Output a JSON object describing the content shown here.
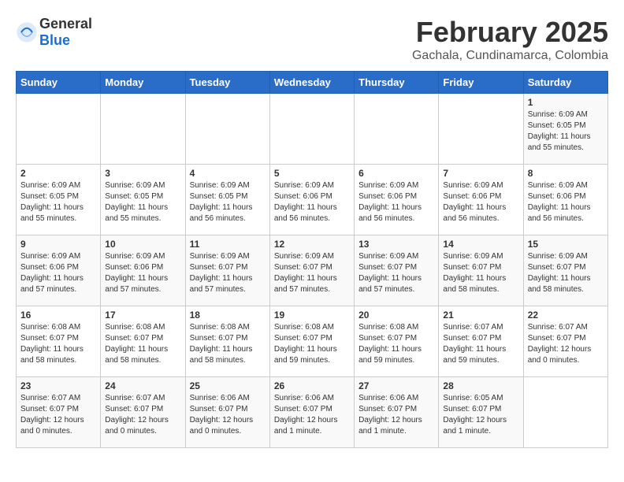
{
  "header": {
    "logo_general": "General",
    "logo_blue": "Blue",
    "month": "February 2025",
    "location": "Gachala, Cundinamarca, Colombia"
  },
  "weekdays": [
    "Sunday",
    "Monday",
    "Tuesday",
    "Wednesday",
    "Thursday",
    "Friday",
    "Saturday"
  ],
  "weeks": [
    [
      {
        "day": "",
        "info": ""
      },
      {
        "day": "",
        "info": ""
      },
      {
        "day": "",
        "info": ""
      },
      {
        "day": "",
        "info": ""
      },
      {
        "day": "",
        "info": ""
      },
      {
        "day": "",
        "info": ""
      },
      {
        "day": "1",
        "info": "Sunrise: 6:09 AM\nSunset: 6:05 PM\nDaylight: 11 hours\nand 55 minutes."
      }
    ],
    [
      {
        "day": "2",
        "info": "Sunrise: 6:09 AM\nSunset: 6:05 PM\nDaylight: 11 hours\nand 55 minutes."
      },
      {
        "day": "3",
        "info": "Sunrise: 6:09 AM\nSunset: 6:05 PM\nDaylight: 11 hours\nand 55 minutes."
      },
      {
        "day": "4",
        "info": "Sunrise: 6:09 AM\nSunset: 6:05 PM\nDaylight: 11 hours\nand 56 minutes."
      },
      {
        "day": "5",
        "info": "Sunrise: 6:09 AM\nSunset: 6:06 PM\nDaylight: 11 hours\nand 56 minutes."
      },
      {
        "day": "6",
        "info": "Sunrise: 6:09 AM\nSunset: 6:06 PM\nDaylight: 11 hours\nand 56 minutes."
      },
      {
        "day": "7",
        "info": "Sunrise: 6:09 AM\nSunset: 6:06 PM\nDaylight: 11 hours\nand 56 minutes."
      },
      {
        "day": "8",
        "info": "Sunrise: 6:09 AM\nSunset: 6:06 PM\nDaylight: 11 hours\nand 56 minutes."
      }
    ],
    [
      {
        "day": "9",
        "info": "Sunrise: 6:09 AM\nSunset: 6:06 PM\nDaylight: 11 hours\nand 57 minutes."
      },
      {
        "day": "10",
        "info": "Sunrise: 6:09 AM\nSunset: 6:06 PM\nDaylight: 11 hours\nand 57 minutes."
      },
      {
        "day": "11",
        "info": "Sunrise: 6:09 AM\nSunset: 6:07 PM\nDaylight: 11 hours\nand 57 minutes."
      },
      {
        "day": "12",
        "info": "Sunrise: 6:09 AM\nSunset: 6:07 PM\nDaylight: 11 hours\nand 57 minutes."
      },
      {
        "day": "13",
        "info": "Sunrise: 6:09 AM\nSunset: 6:07 PM\nDaylight: 11 hours\nand 57 minutes."
      },
      {
        "day": "14",
        "info": "Sunrise: 6:09 AM\nSunset: 6:07 PM\nDaylight: 11 hours\nand 58 minutes."
      },
      {
        "day": "15",
        "info": "Sunrise: 6:09 AM\nSunset: 6:07 PM\nDaylight: 11 hours\nand 58 minutes."
      }
    ],
    [
      {
        "day": "16",
        "info": "Sunrise: 6:08 AM\nSunset: 6:07 PM\nDaylight: 11 hours\nand 58 minutes."
      },
      {
        "day": "17",
        "info": "Sunrise: 6:08 AM\nSunset: 6:07 PM\nDaylight: 11 hours\nand 58 minutes."
      },
      {
        "day": "18",
        "info": "Sunrise: 6:08 AM\nSunset: 6:07 PM\nDaylight: 11 hours\nand 58 minutes."
      },
      {
        "day": "19",
        "info": "Sunrise: 6:08 AM\nSunset: 6:07 PM\nDaylight: 11 hours\nand 59 minutes."
      },
      {
        "day": "20",
        "info": "Sunrise: 6:08 AM\nSunset: 6:07 PM\nDaylight: 11 hours\nand 59 minutes."
      },
      {
        "day": "21",
        "info": "Sunrise: 6:07 AM\nSunset: 6:07 PM\nDaylight: 11 hours\nand 59 minutes."
      },
      {
        "day": "22",
        "info": "Sunrise: 6:07 AM\nSunset: 6:07 PM\nDaylight: 12 hours\nand 0 minutes."
      }
    ],
    [
      {
        "day": "23",
        "info": "Sunrise: 6:07 AM\nSunset: 6:07 PM\nDaylight: 12 hours\nand 0 minutes."
      },
      {
        "day": "24",
        "info": "Sunrise: 6:07 AM\nSunset: 6:07 PM\nDaylight: 12 hours\nand 0 minutes."
      },
      {
        "day": "25",
        "info": "Sunrise: 6:06 AM\nSunset: 6:07 PM\nDaylight: 12 hours\nand 0 minutes."
      },
      {
        "day": "26",
        "info": "Sunrise: 6:06 AM\nSunset: 6:07 PM\nDaylight: 12 hours\nand 1 minute."
      },
      {
        "day": "27",
        "info": "Sunrise: 6:06 AM\nSunset: 6:07 PM\nDaylight: 12 hours\nand 1 minute."
      },
      {
        "day": "28",
        "info": "Sunrise: 6:05 AM\nSunset: 6:07 PM\nDaylight: 12 hours\nand 1 minute."
      },
      {
        "day": "",
        "info": ""
      }
    ]
  ]
}
